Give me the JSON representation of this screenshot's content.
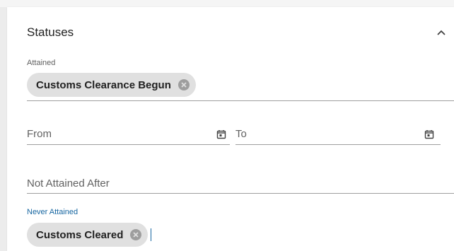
{
  "section": {
    "title": "Statuses",
    "collapse_icon": "chevron-up-icon"
  },
  "attained": {
    "label": "Attained",
    "chips": [
      {
        "label": "Customs Clearance Begun",
        "remove_icon": "cancel-circle-icon"
      }
    ]
  },
  "date_range": {
    "from_placeholder": "From",
    "to_placeholder": "To",
    "calendar_icon": "calendar-icon"
  },
  "not_attained_after": {
    "placeholder": "Not Attained After"
  },
  "never_attained": {
    "label": "Never Attained",
    "chips": [
      {
        "label": "Customs Cleared",
        "remove_icon": "cancel-circle-icon"
      }
    ]
  },
  "colors": {
    "active_accent": "#1565a0",
    "chip_background": "#e0e0e0",
    "underline": "#9e9e9e"
  }
}
